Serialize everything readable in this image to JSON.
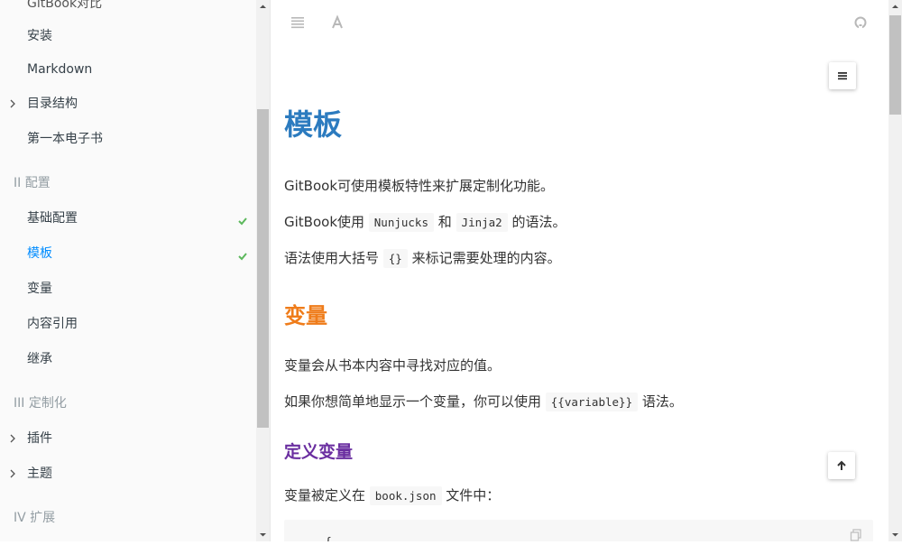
{
  "sidebar": {
    "items_top": [
      {
        "label": "GitBook对比"
      },
      {
        "label": "安装"
      },
      {
        "label": "Markdown"
      },
      {
        "label": "目录结构"
      },
      {
        "label": "第一本电子书"
      }
    ],
    "section_config": "II 配置",
    "config_items": [
      {
        "label": "基础配置"
      },
      {
        "label": "模板"
      },
      {
        "label": "变量"
      },
      {
        "label": "内容引用"
      },
      {
        "label": "继承"
      }
    ],
    "section_custom": "III 定制化",
    "custom_items": [
      {
        "label": "插件"
      },
      {
        "label": "主题"
      }
    ],
    "section_extend": "IV 扩展"
  },
  "content": {
    "title": "模板",
    "p1": "GitBook可使用模板特性来扩展定制化功能。",
    "p2": {
      "a": "GitBook使用 ",
      "code1": "Nunjucks",
      "b": " 和 ",
      "code2": "Jinja2",
      "c": " 的语法。"
    },
    "p3": {
      "a": "语法使用大括号 ",
      "code": "{}",
      "b": " 来标记需要处理的内容。"
    },
    "h2": "变量",
    "p4": "变量会从书本内容中寻找对应的值。",
    "p5": {
      "a": "如果你想简单地显示一个变量，你可以使用 ",
      "code": "{{variable}}",
      "b": " 语法。"
    },
    "h3": "定义变量",
    "p6": {
      "a": "变量被定义在 ",
      "code": "book.json",
      "b": " 文件中："
    },
    "code_block_first_line": "{"
  },
  "icons": {
    "toc": "list-icon",
    "font": "font-icon",
    "github": "github-icon",
    "menu": "menu-icon",
    "back_to_top": "arrow-up-icon",
    "copy": "copy-icon",
    "check": "check-icon"
  },
  "colors": {
    "h1": "#2c7bbf",
    "h2": "#ef7c1a",
    "h3": "#6a2ea0",
    "active_link": "#008cff",
    "check": "#5cb85c"
  }
}
